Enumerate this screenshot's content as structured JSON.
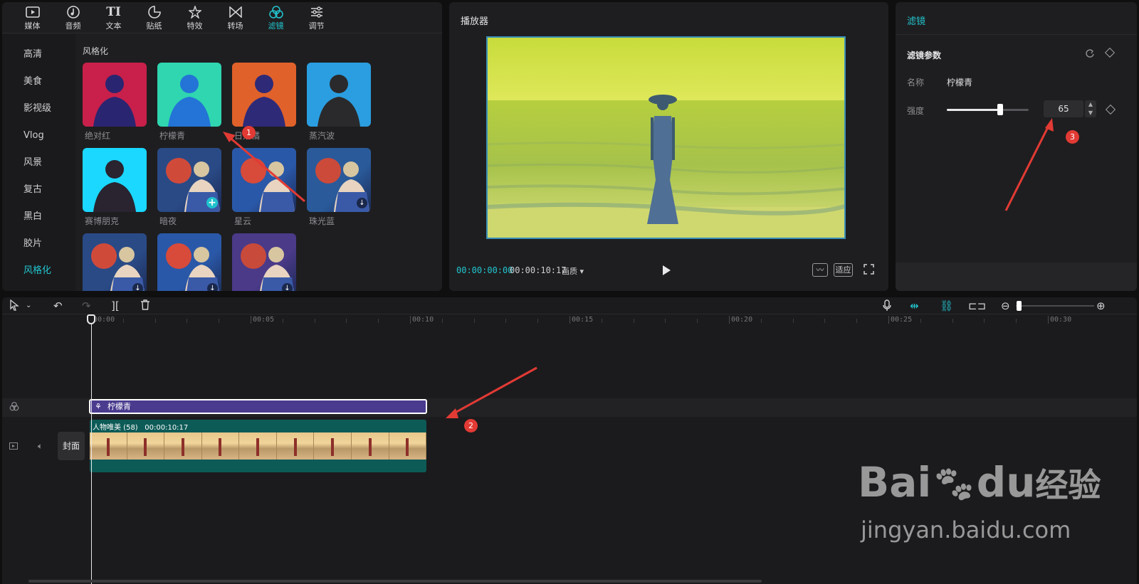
{
  "library": {
    "tabs": [
      {
        "label": "媒体",
        "icon": "media-icon"
      },
      {
        "label": "音频",
        "icon": "audio-icon"
      },
      {
        "label": "文本",
        "icon": "text-icon"
      },
      {
        "label": "贴纸",
        "icon": "sticker-icon"
      },
      {
        "label": "特效",
        "icon": "effects-icon"
      },
      {
        "label": "转场",
        "icon": "transition-icon"
      },
      {
        "label": "滤镜",
        "icon": "filter-icon",
        "active": true
      },
      {
        "label": "调节",
        "icon": "adjust-icon"
      }
    ],
    "categories": [
      "高清",
      "美食",
      "影视级",
      "Vlog",
      "风景",
      "复古",
      "黑白",
      "胶片",
      "风格化"
    ],
    "active_category": "风格化",
    "section_title": "风格化",
    "filters": [
      {
        "label": "绝对红",
        "style": "red"
      },
      {
        "label": "柠檬青",
        "style": "teal"
      },
      {
        "label": "日落橘",
        "style": "orange"
      },
      {
        "label": "蒸汽波",
        "style": "blue"
      },
      {
        "label": "赛博朋克",
        "style": "cyan"
      },
      {
        "label": "暗夜",
        "style": "night",
        "action": "add"
      },
      {
        "label": "星云",
        "style": "nebula"
      },
      {
        "label": "珠光蓝",
        "style": "pearl",
        "action": "download"
      },
      {
        "label": "",
        "style": "night",
        "action": "download"
      },
      {
        "label": "",
        "style": "nebula",
        "action": "download"
      },
      {
        "label": "",
        "style": "purple",
        "action": "download"
      }
    ]
  },
  "player": {
    "title": "播放器",
    "current_time": "00:00:00:00",
    "total_time": "00:00:10:17",
    "quality_label": "画质",
    "fit_label": "适应"
  },
  "params": {
    "tab": "滤镜",
    "section": "滤镜参数",
    "name_label": "名称",
    "name_value": "柠檬青",
    "strength_label": "强度",
    "strength_value": "65",
    "strength_fraction": 0.65
  },
  "timeline": {
    "ruler": [
      "00:00",
      "00:05",
      "00:10",
      "00:15",
      "00:20",
      "00:25",
      "00:30"
    ],
    "filter_clip": "柠檬青",
    "video_clip_name": "人物唯美 (58)",
    "video_clip_duration": "00:00:10:17",
    "cover_label": "封面"
  },
  "annotations": [
    "1",
    "2",
    "3"
  ],
  "watermark": {
    "main": "Bai",
    "sub": "du",
    "brand": "经验",
    "url": "jingyan.baidu.com"
  }
}
